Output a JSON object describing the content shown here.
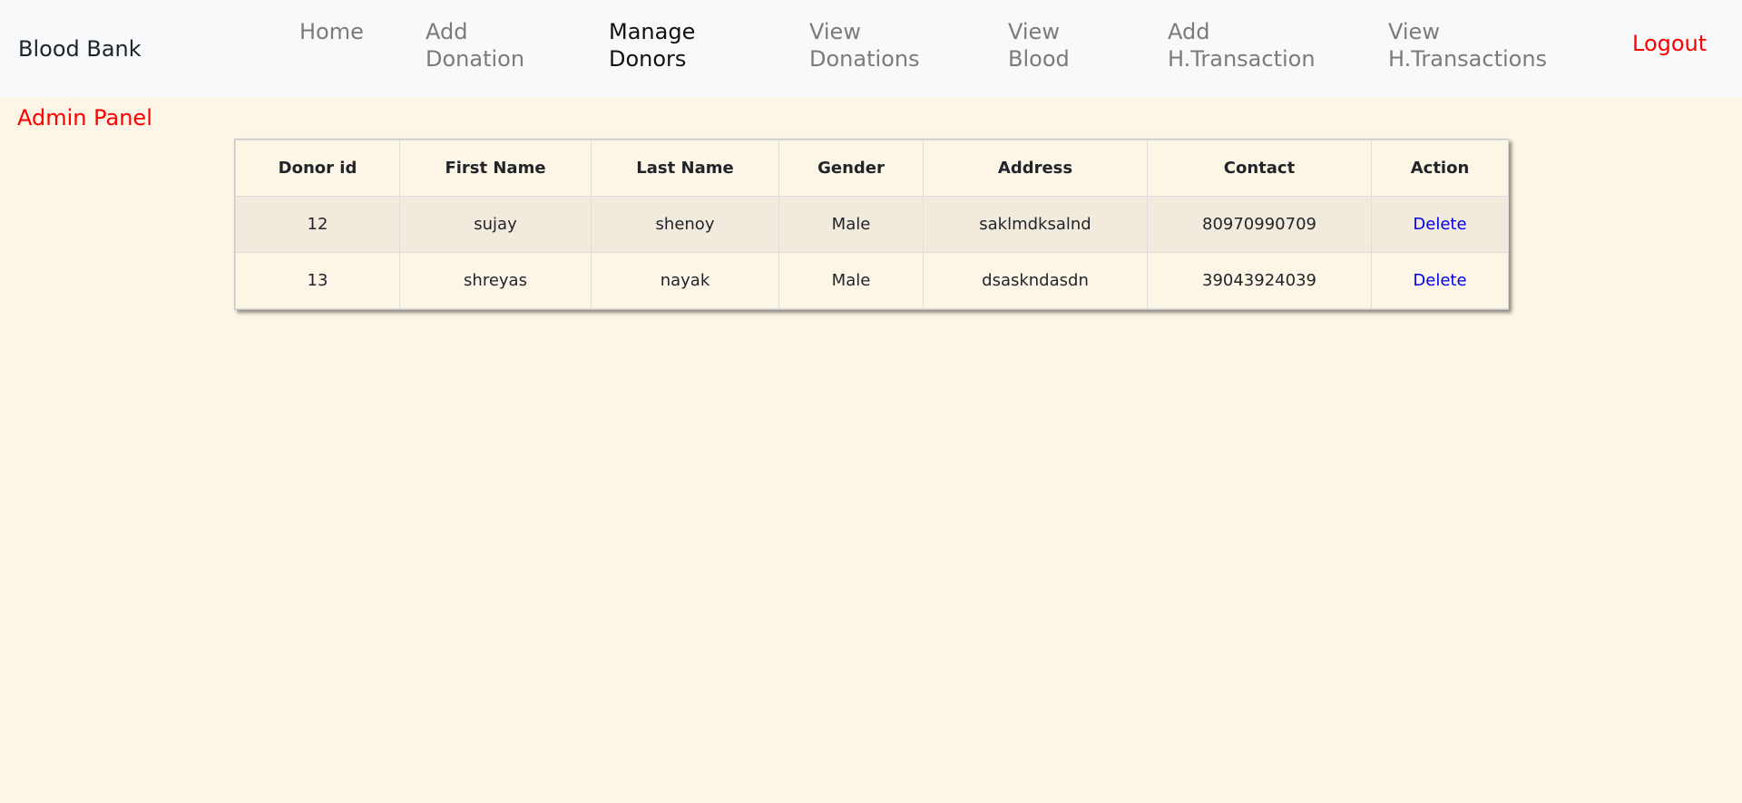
{
  "navbar": {
    "brand": "Blood Bank",
    "links": [
      {
        "line1": "Home",
        "line2": ""
      },
      {
        "line1": "Add",
        "line2": "Donation"
      },
      {
        "line1": "Manage",
        "line2": "Donors"
      },
      {
        "line1": "View",
        "line2": "Donations"
      },
      {
        "line1": "View",
        "line2": "Blood"
      },
      {
        "line1": "Add",
        "line2": "H.Transaction"
      },
      {
        "line1": "View",
        "line2": "H.Transactions"
      }
    ],
    "logout": "Logout"
  },
  "panel_title": "Admin Panel",
  "table": {
    "headers": [
      "Donor id",
      "First Name",
      "Last Name",
      "Gender",
      "Address",
      "Contact",
      "Action"
    ],
    "rows": [
      {
        "donor_id": "12",
        "first_name": "sujay",
        "last_name": "shenoy",
        "gender": "Male",
        "address": "saklmdksalnd",
        "contact": "80970990709",
        "action": "Delete"
      },
      {
        "donor_id": "13",
        "first_name": "shreyas",
        "last_name": "nayak",
        "gender": "Male",
        "address": "dsaskndasdn",
        "contact": "39043924039",
        "action": "Delete"
      }
    ]
  },
  "colors": {
    "background": "#fdf5e6",
    "navbar_bg": "#f8f9fa",
    "accent_red": "#ff0000",
    "link_blue": "#0000ee",
    "nav_muted": "#7b7b7b"
  }
}
